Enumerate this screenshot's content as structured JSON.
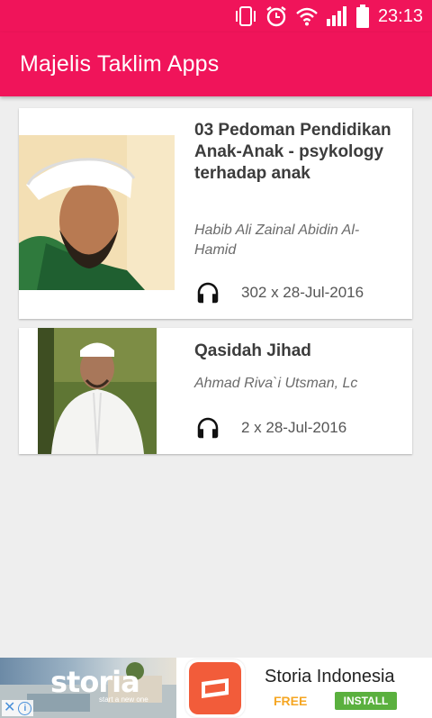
{
  "status_bar": {
    "time": "23:13",
    "icons": [
      "phone-vibrate-icon",
      "alarm-icon",
      "wifi-icon",
      "signal-icon",
      "battery-icon"
    ]
  },
  "app_bar": {
    "title": "Majelis Taklim Apps"
  },
  "items": [
    {
      "title": "03 Pedoman Pendidikan Anak-Anak - psykology terhadap anak",
      "author": "Habib Ali Zainal Abidin Al-Hamid",
      "meta": "302 x 28-Jul-2016",
      "icon": "headphones-icon"
    },
    {
      "title": "Qasidah Jihad",
      "author": "Ahmad Riva`i Utsman, Lc",
      "meta": "2 x 28-Jul-2016",
      "icon": "headphones-icon"
    }
  ],
  "ad": {
    "brand": "storia",
    "tagline": "start a new one",
    "app_name": "Storia Indonesia",
    "price": "FREE",
    "install_label": "INSTALL",
    "close_symbol": "✕",
    "info_symbol": "i"
  },
  "colors": {
    "primary": "#f0145a",
    "background": "#eeeeee",
    "install": "#5ab03e",
    "free": "#f5a623"
  }
}
